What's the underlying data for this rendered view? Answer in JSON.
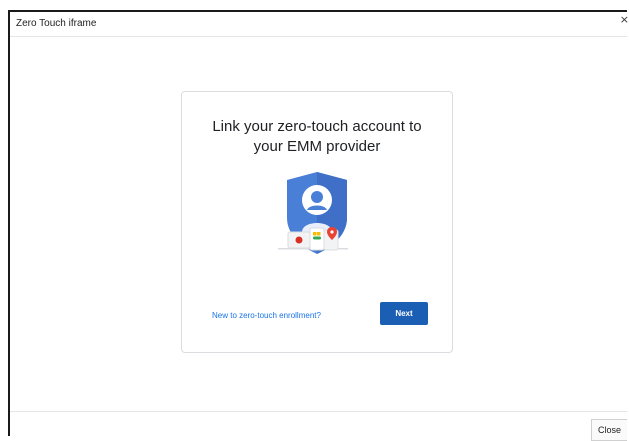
{
  "dialog": {
    "title": "Zero Touch iframe",
    "close_glyph": "×",
    "close_button_label": "Close"
  },
  "card": {
    "title_line1": "Link your zero-touch account to",
    "title_line2": "your EMM provider",
    "illustration": "shield-with-user-and-devices-icon",
    "new_link_label": "New to zero-touch enrollment?",
    "next_button_label": "Next"
  },
  "colors": {
    "accent_blue": "#1a73e8",
    "button_blue": "#1a5fb4",
    "shield_blue": "#4a7fd8"
  }
}
